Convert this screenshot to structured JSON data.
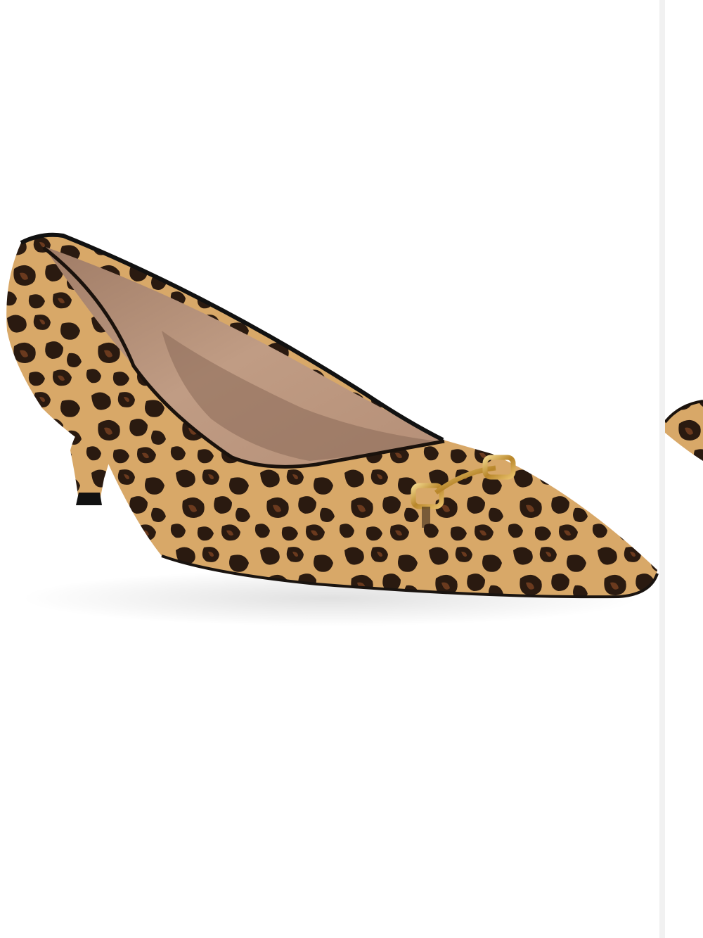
{
  "gallery": {
    "current_image": {
      "subject": "leopard-print-kitty-heel-pump",
      "pattern_colors": {
        "base": "#d8a868",
        "spot_dark": "#2a1a10",
        "spot_brown": "#6b3a1e",
        "lining": "#b08a72",
        "hardware_gold": "#c99a3a"
      }
    },
    "next_image_peek": {
      "subject": "leopard-print-pump-toe"
    },
    "divider_color": "#f1f1f1",
    "background_color": "#ffffff"
  }
}
